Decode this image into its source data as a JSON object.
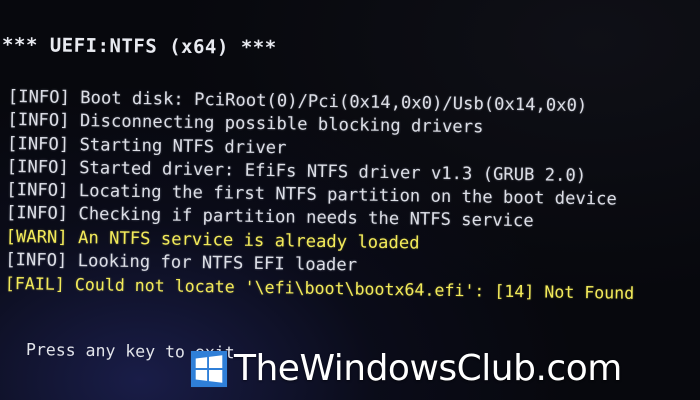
{
  "title": "*** UEFI:NTFS (x64) ***",
  "log": [
    {
      "tag": "[INFO]",
      "message": " Boot disk: PciRoot(0)/Pci(0x14,0x0)/Usb(0x14,0x0)",
      "level": "info"
    },
    {
      "tag": "[INFO]",
      "message": " Disconnecting possible blocking drivers",
      "level": "info"
    },
    {
      "tag": "[INFO]",
      "message": " Starting NTFS driver",
      "level": "info"
    },
    {
      "tag": "[INFO]",
      "message": " Started driver: EfiFs NTFS driver v1.3 (GRUB 2.0)",
      "level": "info"
    },
    {
      "tag": "[INFO]",
      "message": " Locating the first NTFS partition on the boot device",
      "level": "info"
    },
    {
      "tag": "[INFO]",
      "message": " Checking if partition needs the NTFS service",
      "level": "info"
    },
    {
      "tag": "[WARN]",
      "message": " An NTFS service is already loaded",
      "level": "warn"
    },
    {
      "tag": "[INFO]",
      "message": " Looking for NTFS EFI loader",
      "level": "info"
    },
    {
      "tag": "[FAIL]",
      "message": " Could not locate '\\efi\\boot\\bootx64.efi': [14] Not Found",
      "level": "fail"
    }
  ],
  "prompt": "Press any key to exit",
  "watermark": {
    "text": "TheWindowsClub.com",
    "logo_icon": "windows-logo-icon",
    "logo_color": "#3a8ee6"
  },
  "colors": {
    "background": "#07080d",
    "info_text": "#dcdee6",
    "warn_fail_text": "#f2ea5a"
  }
}
